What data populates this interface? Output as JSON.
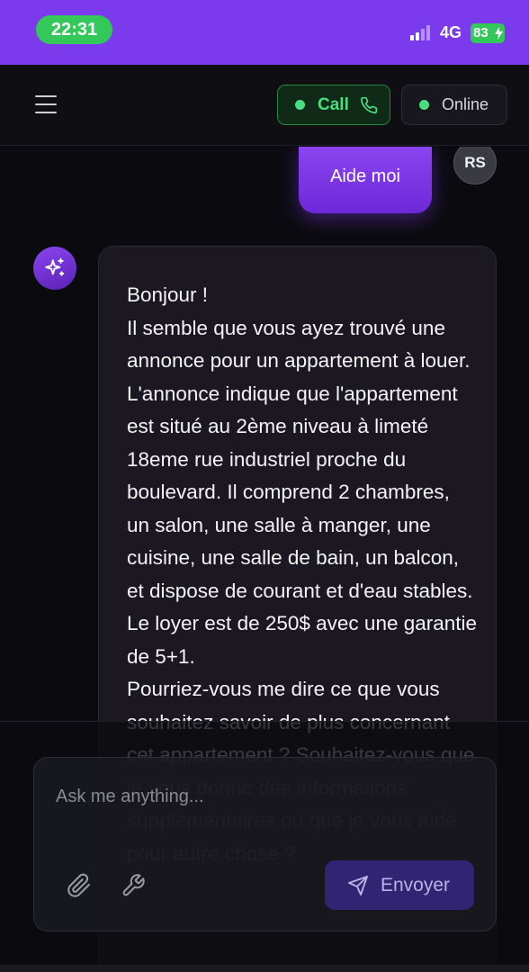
{
  "status_bar": {
    "time": "22:31",
    "network": "4G",
    "battery": "83"
  },
  "header": {
    "call_label": "Call",
    "status_label": "Online"
  },
  "chat": {
    "user_message": "Aide moi",
    "user_initials": "RS",
    "ai_message": "Bonjour !\nIl semble que vous ayez trouvé une annonce pour un appartement à louer. L'annonce indique que l'appartement est situé au 2ème niveau à limeté 18eme rue industriel proche du boulevard. Il comprend 2 chambres, un salon, une salle à manger, une cuisine, une salle de bain, un balcon, et dispose de courant et d'eau stables.\nLe loyer est de 250$ avec une garantie de 5+1.\nPourriez-vous me dire ce que vous souhaitez savoir de plus concernant cet appartement ? Souhaitez-vous que je vous donne des informations supplémentaires ou que je vous aide pour autre chose ?"
  },
  "composer": {
    "placeholder": "Ask me anything...",
    "send_label": "Envoyer"
  },
  "colors": {
    "accent": "#7c3aed",
    "online_green": "#4ade80",
    "status_green": "#34c759"
  },
  "icons": [
    "menu-icon",
    "phone-icon",
    "sparkles-icon",
    "paperclip-icon",
    "wrench-icon",
    "send-icon",
    "signal-icon",
    "battery-icon"
  ]
}
